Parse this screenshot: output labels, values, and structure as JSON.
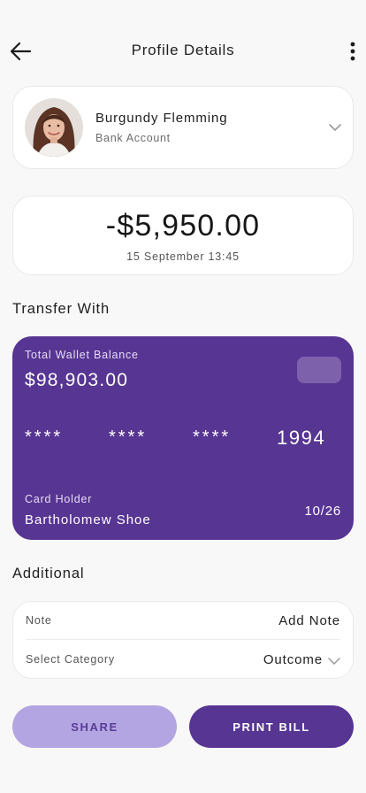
{
  "header": {
    "title": "Profile Details",
    "back_icon": "arrow-left-icon",
    "more_icon": "more-vertical-icon"
  },
  "profile": {
    "name": "Burgundy Flemming",
    "subtitle": "Bank Account"
  },
  "transaction": {
    "amount": "-$5,950.00",
    "datetime": "15 September 13:45"
  },
  "transfer_section": {
    "title": "Transfer With"
  },
  "wallet": {
    "label": "Total Wallet Balance",
    "balance": "$98,903.00",
    "mask_1": "****",
    "mask_2": "****",
    "mask_3": "****",
    "last_digits": "1994",
    "holder_label": "Card Holder",
    "holder_name": "Bartholomew Shoe",
    "expiry": "10/26",
    "color": "#573593"
  },
  "additional": {
    "title": "Additional",
    "note_label": "Note",
    "note_action": "Add Note",
    "category_label": "Select Category",
    "category_value": "Outcome"
  },
  "actions": {
    "share": "SHARE",
    "print": "PRINT BILL"
  },
  "colors": {
    "accent": "#573593",
    "accent_light": "#b3a5e1",
    "background": "#f8f8f8"
  }
}
